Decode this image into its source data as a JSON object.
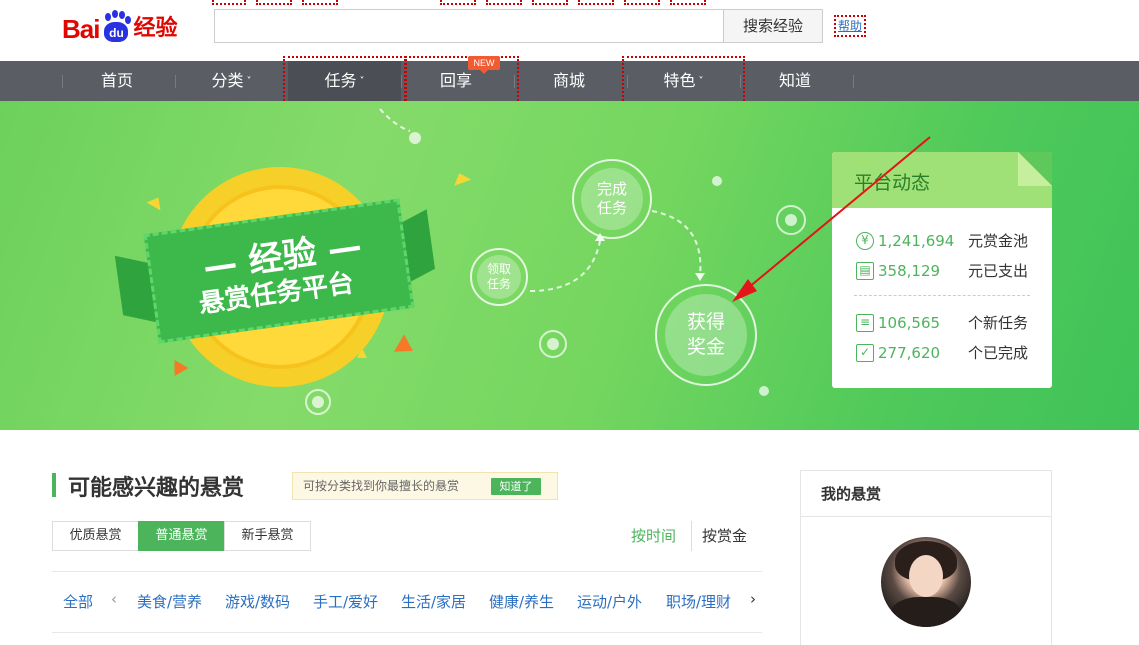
{
  "header": {
    "logo_bai": "Bai",
    "logo_du": "du",
    "logo_jingyan": "经验",
    "search_placeholder": "",
    "search_button": "搜索经验",
    "help": "帮助"
  },
  "nav": {
    "items": [
      {
        "label": "首页",
        "chevron": ""
      },
      {
        "label": "分类",
        "chevron": "˅"
      },
      {
        "label": "任务",
        "chevron": "˅"
      },
      {
        "label": "回享",
        "chevron": ""
      },
      {
        "label": "商城",
        "chevron": ""
      },
      {
        "label": "特色",
        "chevron": "˅"
      },
      {
        "label": "知道",
        "chevron": ""
      }
    ],
    "new_badge": "NEW"
  },
  "banner": {
    "ribbon_line1": "— 经验 —",
    "ribbon_line2": "悬赏任务平台",
    "step_receive": "领取\n任务",
    "step_complete": "完成\n任务",
    "step_reward": "获得\n奖金"
  },
  "platform": {
    "title": "平台动态",
    "stats": [
      {
        "icon": "¥",
        "value": "1,241,694",
        "label": "元赏金池"
      },
      {
        "icon": "▤",
        "value": "358,129",
        "label": "元已支出"
      },
      {
        "icon": "≡",
        "value": "106,565",
        "label": "个新任务"
      },
      {
        "icon": "✓",
        "value": "277,620",
        "label": "个已完成"
      }
    ]
  },
  "section": {
    "title": "可能感兴趣的悬赏",
    "tip": "可按分类找到你最擅长的悬赏",
    "tip_button": "知道了",
    "tabs": [
      "优质悬赏",
      "普通悬赏",
      "新手悬赏"
    ],
    "sort_time": "按时间",
    "sort_reward": "按赏金",
    "categories": [
      "全部",
      "美食/营养",
      "游戏/数码",
      "手工/爱好",
      "生活/家居",
      "健康/养生",
      "运动/户外",
      "职场/理财"
    ],
    "arrow_left": "‹",
    "arrow_right": "›"
  },
  "side": {
    "title": "我的悬赏"
  }
}
